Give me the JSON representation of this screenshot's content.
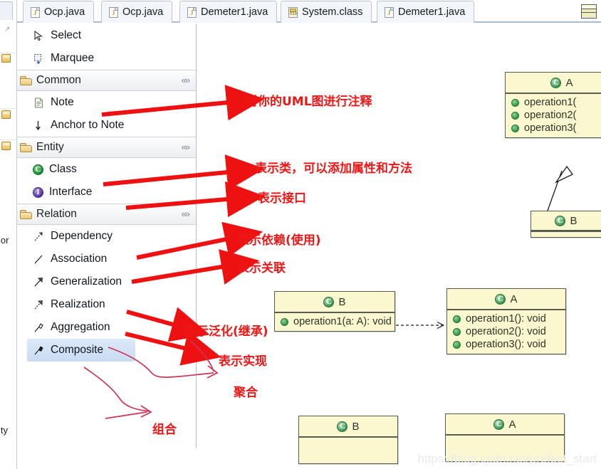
{
  "window": {
    "watermark": "https://blog.csdn.net/prefect_start"
  },
  "left_strip": {
    "cut_labels": [
      "ior",
      "ity"
    ],
    "arrow_glyph": "↗"
  },
  "tabbar": {
    "tabs": [
      {
        "label": "Ocp.java",
        "icon": "java-file-icon",
        "icon_mark": "J",
        "active": false
      },
      {
        "label": "Ocp.java",
        "icon": "java-file-icon",
        "icon_mark": "J",
        "active": false
      },
      {
        "label": "Demeter1.java",
        "icon": "java-file-icon",
        "icon_mark": "J",
        "active": false
      },
      {
        "label": "System.class",
        "icon": "class-file-icon",
        "icon_mark": "010",
        "active": false
      },
      {
        "label": "Demeter1.java",
        "icon": "java-file-icon",
        "icon_mark": "J",
        "active": false
      }
    ],
    "toolbar_button": {
      "name": "uml-class-outline-button",
      "icon": "class-box-icon"
    }
  },
  "palette": {
    "tools": [
      {
        "label": "Select",
        "icon": "cursor-arrow-icon"
      },
      {
        "label": "Marquee",
        "icon": "marquee-select-icon"
      }
    ],
    "groups": [
      {
        "label": "Common",
        "icon": "folder-icon",
        "collapse_glyph": "«»",
        "items": [
          {
            "label": "Note",
            "icon": "note-icon"
          },
          {
            "label": "Anchor to Note",
            "icon": "anchor-arrow-icon"
          }
        ]
      },
      {
        "label": "Entity",
        "icon": "folder-icon",
        "collapse_glyph": "«»",
        "items": [
          {
            "label": "Class",
            "icon": "class-green-icon"
          },
          {
            "label": "Interface",
            "icon": "interface-purple-icon"
          }
        ]
      },
      {
        "label": "Relation",
        "icon": "folder-icon",
        "collapse_glyph": "«»",
        "items": [
          {
            "label": "Dependency",
            "icon": "dashed-arrow-icon",
            "selected": false
          },
          {
            "label": "Association",
            "icon": "plain-line-icon",
            "selected": false
          },
          {
            "label": "Generalization",
            "icon": "solid-arrow-icon",
            "selected": false
          },
          {
            "label": "Realization",
            "icon": "dashed-hollow-arrow-icon",
            "selected": false
          },
          {
            "label": "Aggregation",
            "icon": "hollow-diamond-icon",
            "selected": false
          },
          {
            "label": "Composite",
            "icon": "filled-diamond-icon",
            "selected": true
          }
        ]
      }
    ]
  },
  "annotations": [
    {
      "text": "对你的UML图进行注释",
      "target": "Note"
    },
    {
      "text": "表示类，可以添加属性和方法",
      "target": "Class"
    },
    {
      "text": "表示接口",
      "target": "Interface"
    },
    {
      "text": "表示依赖(使用)",
      "target": "Dependency"
    },
    {
      "text": "表示关联",
      "target": "Association"
    },
    {
      "text": "表示泛化(继承)",
      "target": "Generalization"
    },
    {
      "text": "表示实现",
      "target": "Realization"
    },
    {
      "text": "聚合",
      "target": "Aggregation"
    },
    {
      "text": "组合",
      "target": "Composite"
    }
  ],
  "diagram": {
    "classes": [
      {
        "id": "class-a-top",
        "name": "A",
        "icon": "class-green-icon",
        "members": [
          "operation1(",
          "operation2(",
          "operation3("
        ],
        "clipped_right": true
      },
      {
        "id": "class-b-top",
        "name": "B",
        "icon": "class-green-icon",
        "members": [],
        "clipped_right": true
      },
      {
        "id": "class-b-mid",
        "name": "B",
        "icon": "class-green-icon",
        "members": [
          "operation1(a: A): void"
        ]
      },
      {
        "id": "class-a-mid",
        "name": "A",
        "icon": "class-green-icon",
        "members": [
          "operation1(): void",
          "operation2(): void",
          "operation3(): void"
        ]
      },
      {
        "id": "class-b-bottom",
        "name": "B",
        "icon": "class-green-icon",
        "members": []
      },
      {
        "id": "class-a-bottom",
        "name": "A",
        "icon": "class-green-icon",
        "members": []
      }
    ],
    "relations": [
      {
        "from": "class-b-top",
        "to": "class-a-top",
        "type": "generalization"
      },
      {
        "from": "class-b-mid",
        "to": "class-a-mid",
        "type": "dependency"
      }
    ]
  },
  "colors": {
    "uml_fill": "#fbf8d0",
    "uml_border": "#585c50",
    "annotation_red": "#ef1616",
    "selection_blue": "#c9dcf2",
    "tab_active": "#ffffff"
  }
}
